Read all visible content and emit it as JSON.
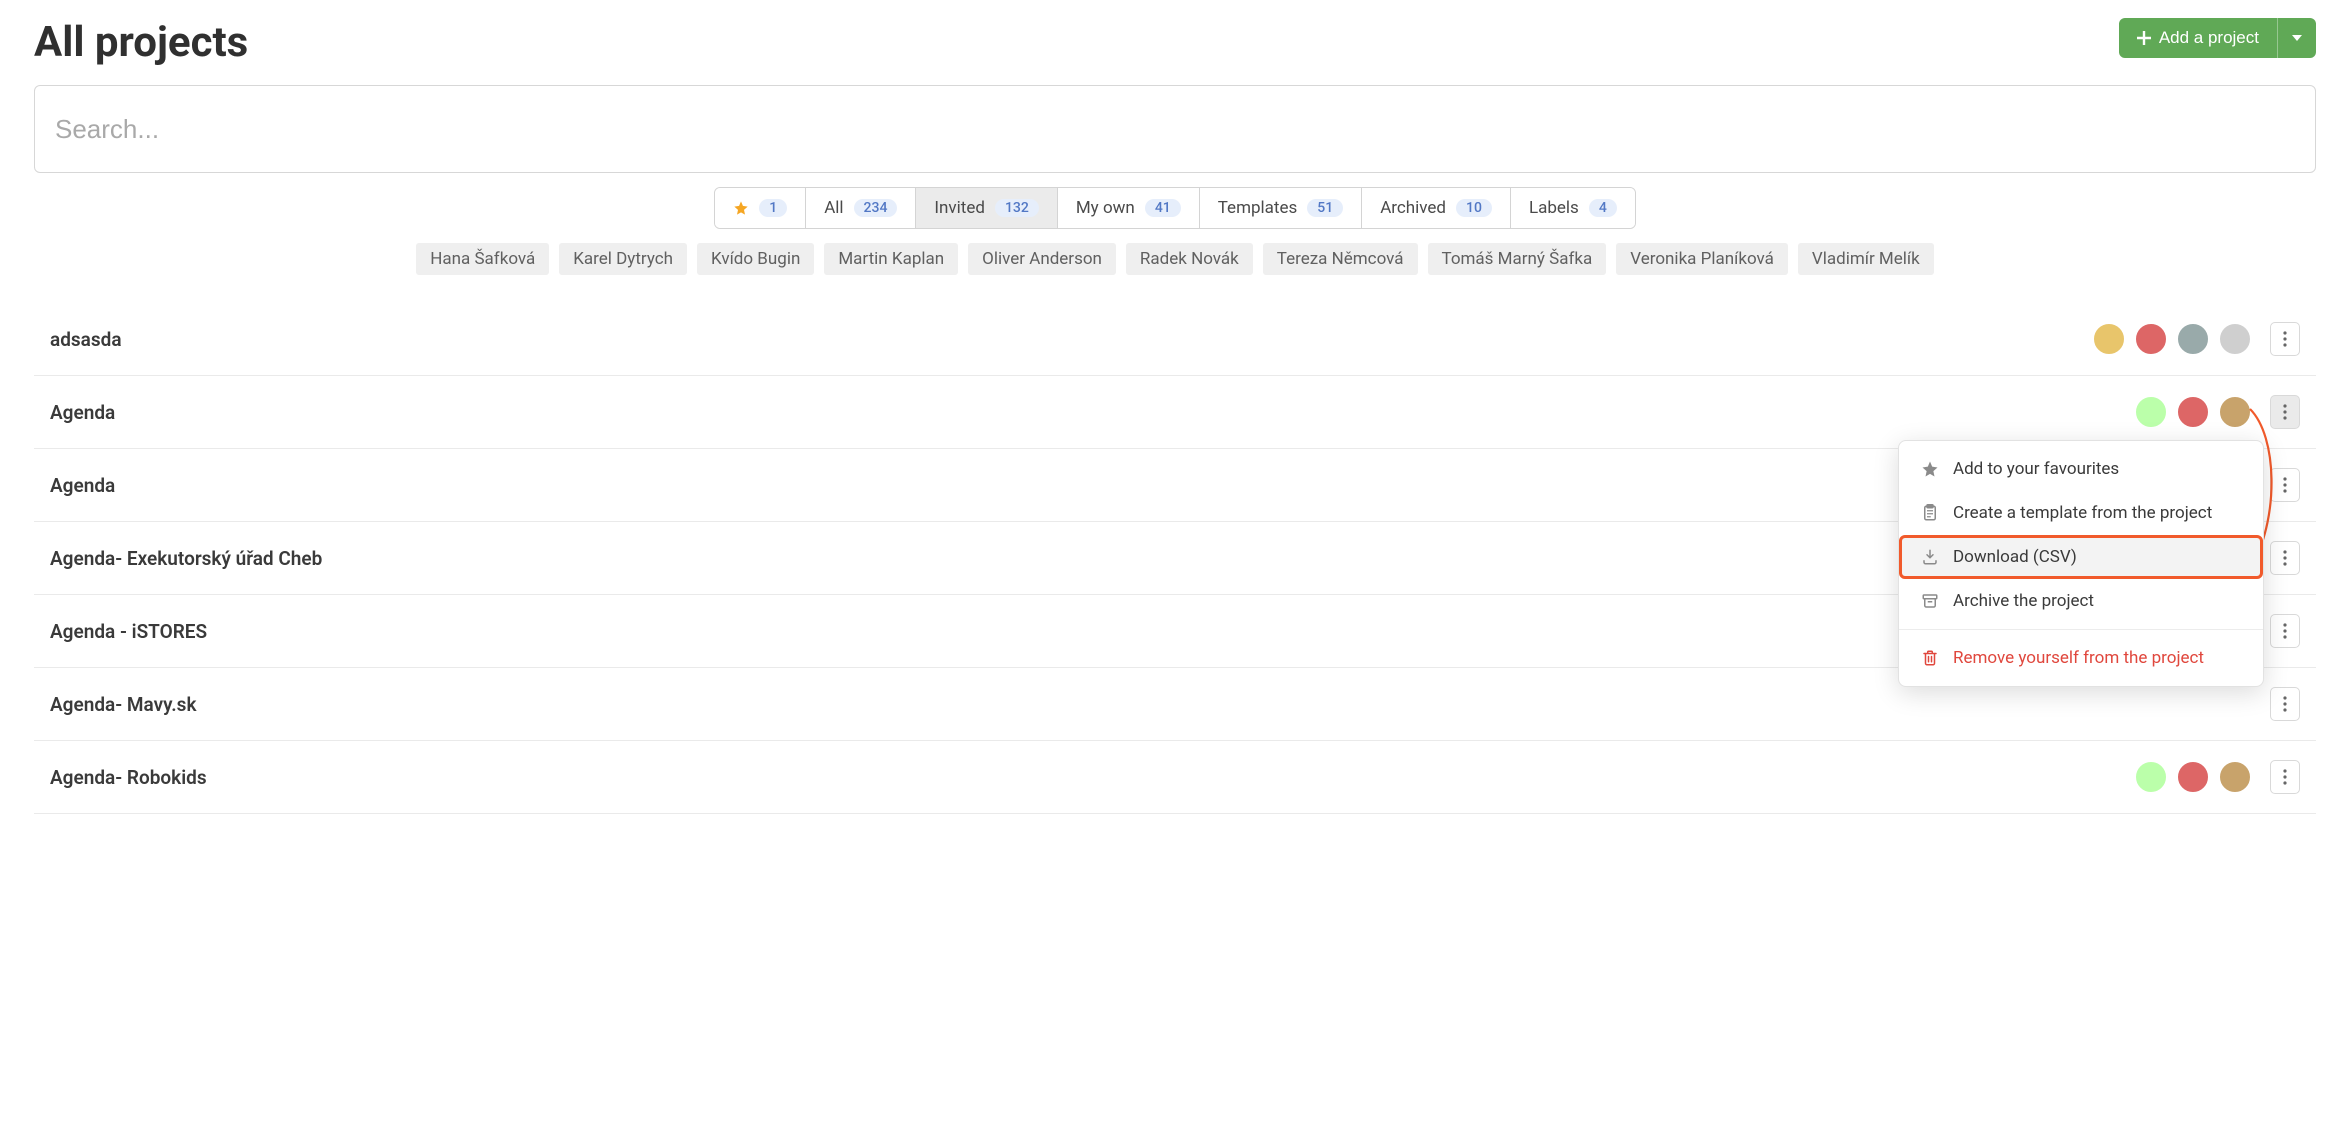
{
  "header": {
    "title": "All projects",
    "add_label": "Add a project"
  },
  "search": {
    "placeholder": "Search..."
  },
  "tabs": [
    {
      "label": "",
      "count": "1",
      "icon": "star"
    },
    {
      "label": "All",
      "count": "234"
    },
    {
      "label": "Invited",
      "count": "132",
      "active": true
    },
    {
      "label": "My own",
      "count": "41"
    },
    {
      "label": "Templates",
      "count": "51"
    },
    {
      "label": "Archived",
      "count": "10"
    },
    {
      "label": "Labels",
      "count": "4"
    }
  ],
  "people": [
    "Hana Šafková",
    "Karel Dytrych",
    "Kvído Bugin",
    "Martin Kaplan",
    "Oliver Anderson",
    "Radek Novák",
    "Tereza Němcová",
    "Tomáš Marný Šafka",
    "Veronika Planíková",
    "Vladimír Melík"
  ],
  "projects": [
    {
      "name": "adsasda",
      "avatars": 4,
      "menu_open": false
    },
    {
      "name": "Agenda",
      "avatars": 3,
      "menu_open": true
    },
    {
      "name": "Agenda",
      "avatars": 0,
      "menu_open": false
    },
    {
      "name": "Agenda- Exekutorský úřad Cheb",
      "avatars": 0,
      "menu_open": false
    },
    {
      "name": "Agenda - iSTORES",
      "avatars": 0,
      "menu_open": false
    },
    {
      "name": "Agenda- Mavy.sk",
      "avatars": 0,
      "menu_open": false
    },
    {
      "name": "Agenda- Robokids",
      "avatars": 3,
      "menu_open": false
    }
  ],
  "dropdown": {
    "favourites": "Add to your favourites",
    "template": "Create a template from the project",
    "download": "Download (CSV)",
    "archive": "Archive the project",
    "remove": "Remove yourself from the project"
  },
  "colors": {
    "accent_green": "#60a956",
    "highlight_orange": "#f15a2b",
    "danger": "#e0473d"
  },
  "avatar_colors": [
    [
      "#e8c56b",
      "#d66",
      "#9aa",
      "#cfcfcf"
    ],
    [
      "#bfa",
      "#d66",
      "#c8a36b"
    ],
    [],
    [],
    [],
    [],
    [
      "#bfa",
      "#d66",
      "#c8a36b"
    ]
  ]
}
